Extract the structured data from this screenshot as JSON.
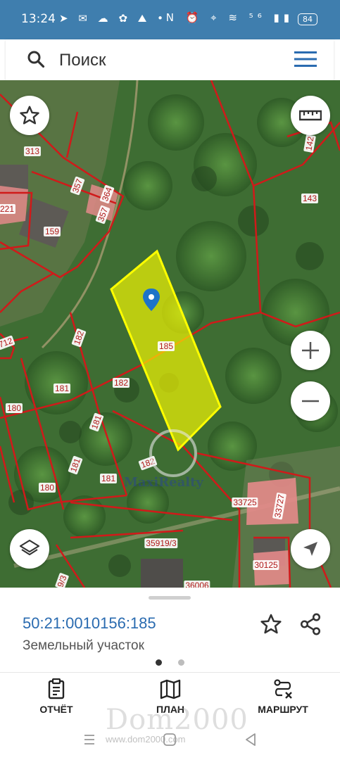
{
  "status_bar": {
    "time": "13:24",
    "left_icons": "➤ ✉ ☁ ✿ ⛰ •",
    "right_icons": "N ⏰ ⌖ ≋ ⁵⁶ ▮▮",
    "battery": "84"
  },
  "search": {
    "placeholder": "Поиск"
  },
  "map": {
    "parcel_labels": [
      {
        "text": "313"
      },
      {
        "text": "357"
      },
      {
        "text": "364"
      },
      {
        "text": "357"
      },
      {
        "text": "221"
      },
      {
        "text": "159"
      },
      {
        "text": "142"
      },
      {
        "text": "143"
      },
      {
        "text": "712"
      },
      {
        "text": "182"
      },
      {
        "text": "181"
      },
      {
        "text": "182"
      },
      {
        "text": "180"
      },
      {
        "text": "181"
      },
      {
        "text": "181"
      },
      {
        "text": "181"
      },
      {
        "text": "182"
      },
      {
        "text": "180"
      },
      {
        "text": "185"
      },
      {
        "text": "33725"
      },
      {
        "text": "33727"
      },
      {
        "text": "35919/3"
      },
      {
        "text": "30125"
      },
      {
        "text": "9/3"
      },
      {
        "text": "36006"
      }
    ],
    "watermark": "MaxiRealty",
    "colors": {
      "parcel_border": "#d01a1a",
      "label_bg": "#ffffff",
      "selected_fill": "#ffff00",
      "marker": "#1e73c8"
    }
  },
  "parcel": {
    "cadastral_number": "50:21:0010156:185",
    "type": "Земельный участок"
  },
  "bottom_nav": {
    "report": "ОТЧЁТ",
    "plan": "ПЛАН",
    "route": "МАРШРУТ"
  },
  "watermark": {
    "logo": "Dom2000",
    "url": "www.dom2000.com"
  }
}
